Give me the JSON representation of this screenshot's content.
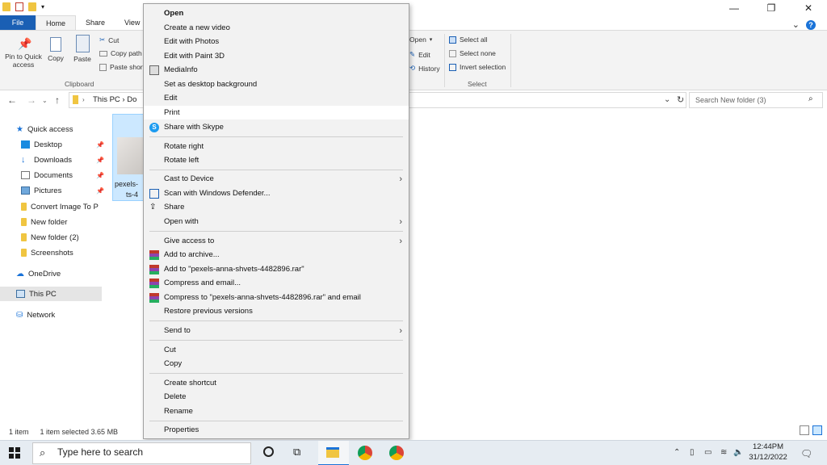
{
  "ribbon": {
    "tabs": [
      "File",
      "Home",
      "Share",
      "View"
    ],
    "clipboard": {
      "pin_label": "Pin to Quick access",
      "copy_label": "Copy",
      "paste_label": "Paste",
      "cut_label": "Cut",
      "copy_path_label": "Copy path",
      "paste_shortcut_label": "Paste short",
      "group_label": "Clipboard"
    },
    "open_group": {
      "open_label": "Open",
      "edit_label": "Edit",
      "history_label": "History"
    },
    "select_group": {
      "select_all_label": "Select all",
      "select_none_label": "Select none",
      "invert_selection_label": "Invert selection",
      "group_label": "Select"
    }
  },
  "address": {
    "path_visible": "This PC  ›  Do",
    "search_placeholder": "Search New folder (3)"
  },
  "nav": {
    "quick_access": "Quick access",
    "items": [
      {
        "label": "Desktop",
        "pinned": true
      },
      {
        "label": "Downloads",
        "pinned": true
      },
      {
        "label": "Documents",
        "pinned": true
      },
      {
        "label": "Pictures",
        "pinned": true
      },
      {
        "label": "Convert Image To P",
        "pinned": false
      },
      {
        "label": "New folder",
        "pinned": false
      },
      {
        "label": "New folder (2)",
        "pinned": false
      },
      {
        "label": "Screenshots",
        "pinned": false
      }
    ],
    "onedrive": "OneDrive",
    "this_pc": "This PC",
    "network": "Network"
  },
  "file": {
    "name_line1": "pexels-",
    "name_line2": "ts-4"
  },
  "status": {
    "count": "1 item",
    "selected": "1 item selected  3.65 MB"
  },
  "context_menu": {
    "items": [
      {
        "label": "Open",
        "bold": true
      },
      {
        "label": "Create a new video"
      },
      {
        "label": "Edit with Photos"
      },
      {
        "label": "Edit with Paint 3D"
      },
      {
        "label": "MediaInfo",
        "icon": "mediainfo-icon"
      },
      {
        "label": "Set as desktop background"
      },
      {
        "label": "Edit"
      },
      {
        "label": "Print"
      },
      {
        "label": "Share with Skype",
        "icon": "skype-icon"
      },
      {
        "label": "Rotate right"
      },
      {
        "label": "Rotate left"
      },
      {
        "label": "Cast to Device",
        "submenu": true
      },
      {
        "label": "Scan with Windows Defender...",
        "icon": "defender-icon"
      },
      {
        "label": "Share",
        "icon": "share-icon"
      },
      {
        "label": "Open with",
        "submenu": true
      },
      {
        "label": "Give access to",
        "submenu": true
      },
      {
        "label": "Add to archive...",
        "icon": "winrar-icon"
      },
      {
        "label": "Add to \"pexels-anna-shvets-4482896.rar\"",
        "icon": "winrar-icon"
      },
      {
        "label": "Compress and email...",
        "icon": "winrar-icon"
      },
      {
        "label": "Compress to \"pexels-anna-shvets-4482896.rar\" and email",
        "icon": "winrar-icon"
      },
      {
        "label": "Restore previous versions"
      },
      {
        "label": "Send to",
        "submenu": true
      },
      {
        "label": "Cut"
      },
      {
        "label": "Copy"
      },
      {
        "label": "Create shortcut"
      },
      {
        "label": "Delete"
      },
      {
        "label": "Rename"
      },
      {
        "label": "Properties"
      }
    ]
  },
  "taskbar": {
    "search_placeholder": "Type here to search",
    "time": "12:44PM",
    "date": "31/12/2022"
  },
  "colors": {
    "accent": "#1a5fb4",
    "selection": "#cce8ff",
    "taskbar": "#e6ecf2"
  }
}
